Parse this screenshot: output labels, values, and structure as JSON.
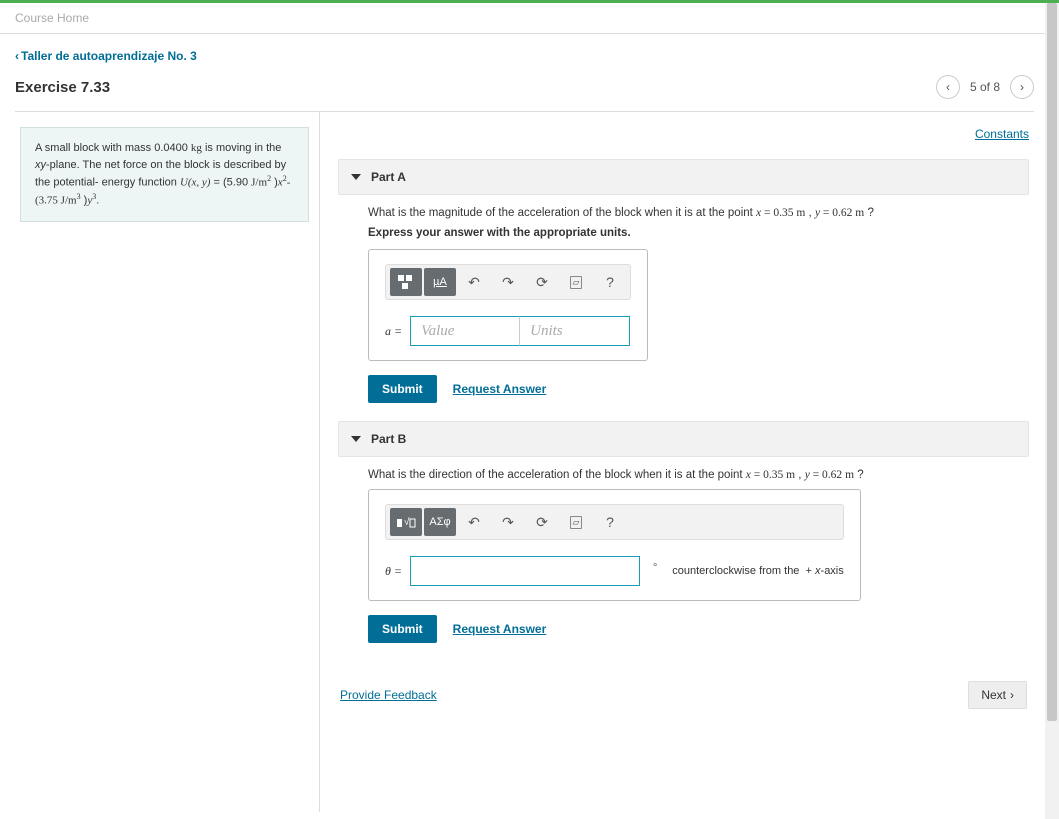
{
  "crumb": "Course Home",
  "breadcrumb": "Taller de autoaprendizaje No. 3",
  "title": "Exercise 7.33",
  "nav_count": "5 of 8",
  "constants": "Constants",
  "prompt": {
    "p1a": "A small block with mass 0.0400 ",
    "kg": "kg",
    "p1b": " is moving in the ",
    "xy": "xy",
    "p1c": "-plane. The net force on the block is described by the potential- energy function ",
    "fn": "U(x, y)",
    "eq": " = (5.90 ",
    "u1": "J/m",
    "sq": "2",
    "mid": " )",
    "x2": "x",
    "dash": "- (3.75 ",
    "u2": "J/m",
    "cu": "3",
    "end": " )",
    "y3": "y",
    "period": "."
  },
  "partA": {
    "label": "Part A",
    "q_a": "What is the magnitude of the acceleration of the block when it is at the point ",
    "qx": "x",
    "qeq1": " = 0.35 ",
    "m1": "m",
    "comma": " , ",
    "qy": "y",
    "qeq2": " = 0.62 ",
    "m2": "m",
    "qmark": " ?",
    "instr": "Express your answer with the appropriate units.",
    "lhs": "a =",
    "ph_val": "Value",
    "ph_unit": "Units",
    "submit": "Submit",
    "request": "Request Answer",
    "tool_mu": "µA"
  },
  "partB": {
    "label": "Part B",
    "q_a": "What is the direction of the acceleration of the block when it is at the point ",
    "qx": "x",
    "qeq1": " = 0.35 ",
    "m1": "m",
    "comma": " , ",
    "qy": "y",
    "qeq2": " = 0.62 ",
    "m2": "m",
    "qmark": " ?",
    "lhs": "θ =",
    "suffix": "counterclockwise from the  + x-axis",
    "submit": "Submit",
    "request": "Request Answer",
    "tool_greek": "ΑΣφ"
  },
  "footer": {
    "feedback": "Provide Feedback",
    "next": "Next"
  }
}
